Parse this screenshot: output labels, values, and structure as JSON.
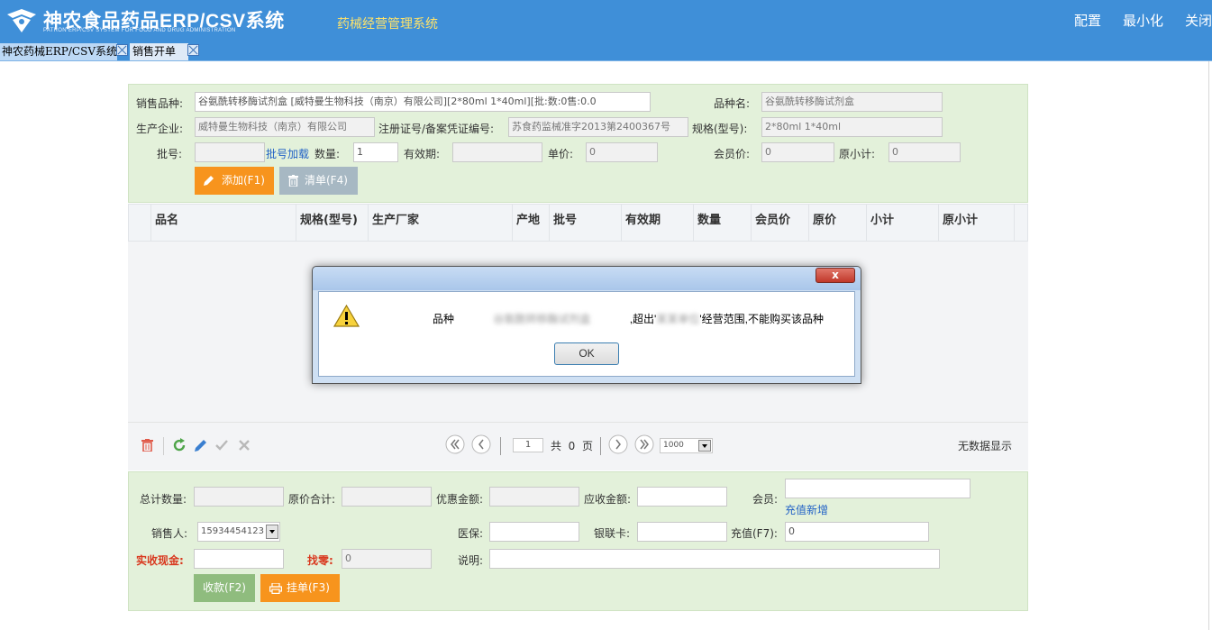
{
  "header": {
    "title": "神农食品药品ERP/CSV系统",
    "subtitle": "PATRON ERP/CSV SYSTEM FOR FOOD AND DRUG ADMINISTRATION",
    "app_name": "药械经营管理系统",
    "actions": [
      "配置",
      "最小化",
      "关闭"
    ]
  },
  "tabs": [
    "神农药械ERP/CSV系统",
    "销售开单"
  ],
  "form": {
    "sale_variety_label": "销售品种:",
    "sale_variety_value": "谷氨酰转移酶试剂盒  [威特曼生物科技（南京）有限公司][2*80ml 1*40ml][批:数:0售:0.0",
    "variety_name_label": "品种名:",
    "variety_name_value": "谷氨酰转移酶试剂盒",
    "manufacturer_label": "生产企业:",
    "manufacturer_value": "威特曼生物科技（南京）有限公司",
    "reg_no_label": "注册证号/备案凭证编号:",
    "reg_no_value": "苏食药监械准字2013第2400367号",
    "spec_label": "规格(型号):",
    "spec_value": "2*80ml 1*40ml",
    "batch_label": "批号:",
    "batch_value": "",
    "batch_load_link": "批号加载",
    "qty_label": "数量:",
    "qty_value": "1",
    "expiry_label": "有效期:",
    "expiry_value": "",
    "unit_price_label": "单价:",
    "unit_price_value": "0",
    "member_price_label": "会员价:",
    "member_price_value": "0",
    "orig_subtotal_label": "原小计:",
    "orig_subtotal_value": "0",
    "add_button": "添加(F1)",
    "clear_button": "清单(F4)"
  },
  "grid": {
    "columns": [
      "品名",
      "规格(型号)",
      "生产厂家",
      "产地",
      "批号",
      "有效期",
      "数量",
      "会员价",
      "原价",
      "小计",
      "原小计"
    ]
  },
  "pager": {
    "page_value": "1",
    "total_prefix": "共",
    "total_pages": "0",
    "total_suffix": "页",
    "page_size": "1000",
    "no_data": "无数据显示"
  },
  "checkout": {
    "total_qty_label": "总计数量:",
    "total_qty_value": "",
    "orig_total_label": "原价合计:",
    "orig_total_value": "",
    "discount_label": "优惠金额:",
    "discount_value": "",
    "receivable_label": "应收金额:",
    "receivable_value": "",
    "member_label": "会员:",
    "member_value": "",
    "recharge_link": "充值新增",
    "seller_label": "销售人:",
    "seller_value": "15934454123",
    "insurance_label": "医保:",
    "insurance_value": "",
    "unionpay_label": "银联卡:",
    "unionpay_value": "",
    "topup_label": "充值(F7):",
    "topup_value": "0",
    "cash_label": "实收现金:",
    "cash_value": "",
    "change_label": "找零:",
    "change_value": "0",
    "note_label": "说明:",
    "note_value": "",
    "collect_button": "收款(F2)",
    "hold_button": "挂单(F3)"
  },
  "dialog": {
    "close_glyph": "x",
    "msg_prefix": "品种",
    "msg_variety": "谷氨酰转移酶试剂盒",
    "msg_middle": ",超出'",
    "msg_customer": "某某单位",
    "msg_suffix": "'经营范围,不能购买该品种",
    "ok_button": "OK"
  },
  "colors": {
    "header_blue": "#3f8fd8",
    "form_green": "#e3f1da",
    "button_orange": "#f7941d",
    "title_yellow": "#ffe36a"
  }
}
